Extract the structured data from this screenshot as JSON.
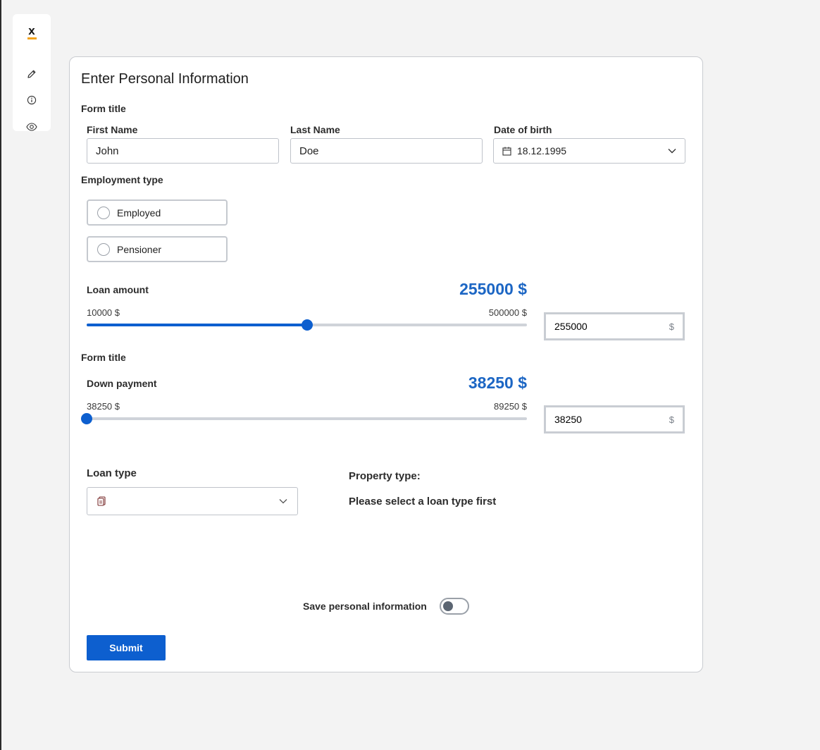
{
  "toolbar": {
    "logo_text": "x",
    "icons": [
      "edit-icon",
      "info-icon",
      "eye-icon"
    ]
  },
  "form": {
    "title": "Enter Personal Information",
    "section1_title": "Form title",
    "first_name": {
      "label": "First Name",
      "value": "John"
    },
    "last_name": {
      "label": "Last Name",
      "value": "Doe"
    },
    "dob": {
      "label": "Date of birth",
      "value": "18.12.1995"
    },
    "employment": {
      "label": "Employment type",
      "options": [
        "Employed",
        "Pensioner"
      ]
    },
    "loan_amount": {
      "label": "Loan amount",
      "display": "255000 $",
      "min_label": "10000 $",
      "max_label": "500000 $",
      "min": 10000,
      "max": 500000,
      "value": 255000,
      "input_value": "255000",
      "unit": "$"
    },
    "section2_title": "Form title",
    "down_payment": {
      "label": "Down payment",
      "display": "38250 $",
      "min_label": "38250 $",
      "max_label": "89250 $",
      "min": 38250,
      "max": 89250,
      "value": 38250,
      "input_value": "38250",
      "unit": "$"
    },
    "loan_type": {
      "label": "Loan type",
      "value": ""
    },
    "property_type": {
      "label": "Property type:",
      "hint": "Please select a loan type first"
    },
    "save_toggle": {
      "label": "Save personal information",
      "on": false
    },
    "submit_label": "Submit"
  },
  "colors": {
    "accent": "#0d5fcf",
    "value_text": "#1c66c4",
    "logo_bar": "#f2a21b"
  }
}
